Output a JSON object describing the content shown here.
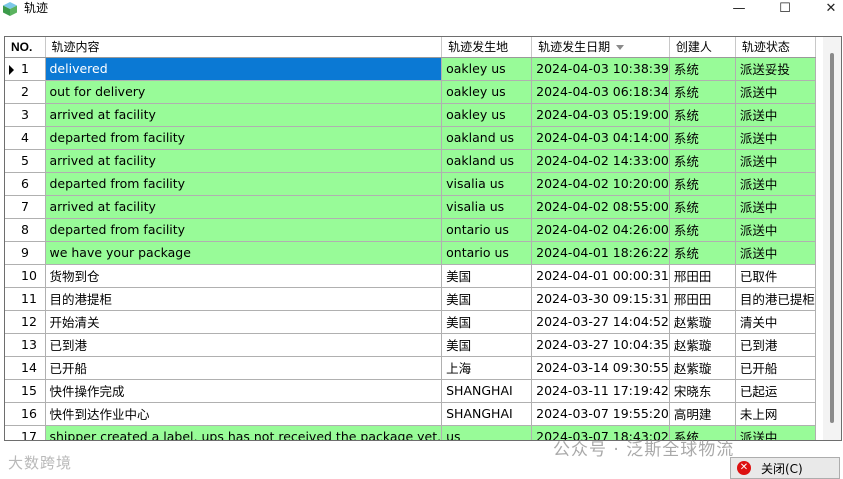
{
  "window": {
    "title": "轨迹",
    "minimize_glyph": "—",
    "maximize_glyph": "☐",
    "close_glyph": "✕"
  },
  "grid": {
    "columns": [
      {
        "label": "NO."
      },
      {
        "label": "轨迹内容"
      },
      {
        "label": "轨迹发生地"
      },
      {
        "label": "轨迹发生日期",
        "sorted": "descending"
      },
      {
        "label": "创建人"
      },
      {
        "label": "轨迹状态"
      }
    ],
    "rows": [
      {
        "no": "1",
        "content": "delivered",
        "place": "oakley us",
        "date": "2024-04-03 10:38:39",
        "creator": "系统",
        "status": "派送妥投",
        "highlight": "green",
        "current": true
      },
      {
        "no": "2",
        "content": "out for delivery",
        "place": "oakley us",
        "date": "2024-04-03 06:18:34",
        "creator": "系统",
        "status": "派送中",
        "highlight": "green"
      },
      {
        "no": "3",
        "content": "arrived at facility",
        "place": "oakley us",
        "date": "2024-04-03 05:19:00",
        "creator": "系统",
        "status": "派送中",
        "highlight": "green"
      },
      {
        "no": "4",
        "content": "departed from facility",
        "place": "oakland us",
        "date": "2024-04-03 04:14:00",
        "creator": "系统",
        "status": "派送中",
        "highlight": "green"
      },
      {
        "no": "5",
        "content": "arrived at facility",
        "place": "oakland us",
        "date": "2024-04-02 14:33:00",
        "creator": "系统",
        "status": "派送中",
        "highlight": "green"
      },
      {
        "no": "6",
        "content": "departed from facility",
        "place": "visalia us",
        "date": "2024-04-02 10:20:00",
        "creator": "系统",
        "status": "派送中",
        "highlight": "green"
      },
      {
        "no": "7",
        "content": "arrived at facility",
        "place": "visalia us",
        "date": "2024-04-02 08:55:00",
        "creator": "系统",
        "status": "派送中",
        "highlight": "green"
      },
      {
        "no": "8",
        "content": "departed from facility",
        "place": "ontario us",
        "date": "2024-04-02 04:26:00",
        "creator": "系统",
        "status": "派送中",
        "highlight": "green"
      },
      {
        "no": "9",
        "content": "we have your package",
        "place": "ontario us",
        "date": "2024-04-01 18:26:22",
        "creator": "系统",
        "status": "派送中",
        "highlight": "green"
      },
      {
        "no": "10",
        "content": "货物到仓",
        "place": "美国",
        "date": "2024-04-01 00:00:31",
        "creator": "邢田田",
        "status": "已取件",
        "highlight": "white"
      },
      {
        "no": "11",
        "content": "目的港提柜",
        "place": "美国",
        "date": "2024-03-30 09:15:31",
        "creator": "邢田田",
        "status": "目的港已提柜",
        "highlight": "white"
      },
      {
        "no": "12",
        "content": "开始清关",
        "place": "美国",
        "date": "2024-03-27 14:04:52",
        "creator": "赵紫璇",
        "status": "清关中",
        "highlight": "white"
      },
      {
        "no": "13",
        "content": "已到港",
        "place": "美国",
        "date": "2024-03-27 10:04:35",
        "creator": "赵紫璇",
        "status": "已到港",
        "highlight": "white"
      },
      {
        "no": "14",
        "content": "已开船",
        "place": "上海",
        "date": "2024-03-14 09:30:55",
        "creator": "赵紫璇",
        "status": "已开船",
        "highlight": "white"
      },
      {
        "no": "15",
        "content": "快件操作完成",
        "place": "SHANGHAI",
        "date": "2024-03-11 17:19:42",
        "creator": "宋晓东",
        "status": "已起运",
        "highlight": "white"
      },
      {
        "no": "16",
        "content": "快件到达作业中心",
        "place": "SHANGHAI",
        "date": "2024-03-07 19:55:20",
        "creator": "高明建",
        "status": "未上网",
        "highlight": "white"
      },
      {
        "no": "17",
        "content": "shipper created a label, ups has not received the package yet.",
        "place": "us",
        "date": "2024-03-07 18:43:02",
        "creator": "系统",
        "status": "派送中",
        "highlight": "green"
      }
    ]
  },
  "footer": {
    "close_button_label": "关闭(C)",
    "watermark_left": "大数跨境",
    "watermark_right": "公众号 · 泛斯全球物流"
  },
  "colors": {
    "row_green": "#98fb98",
    "selection": "#0b79d4"
  }
}
